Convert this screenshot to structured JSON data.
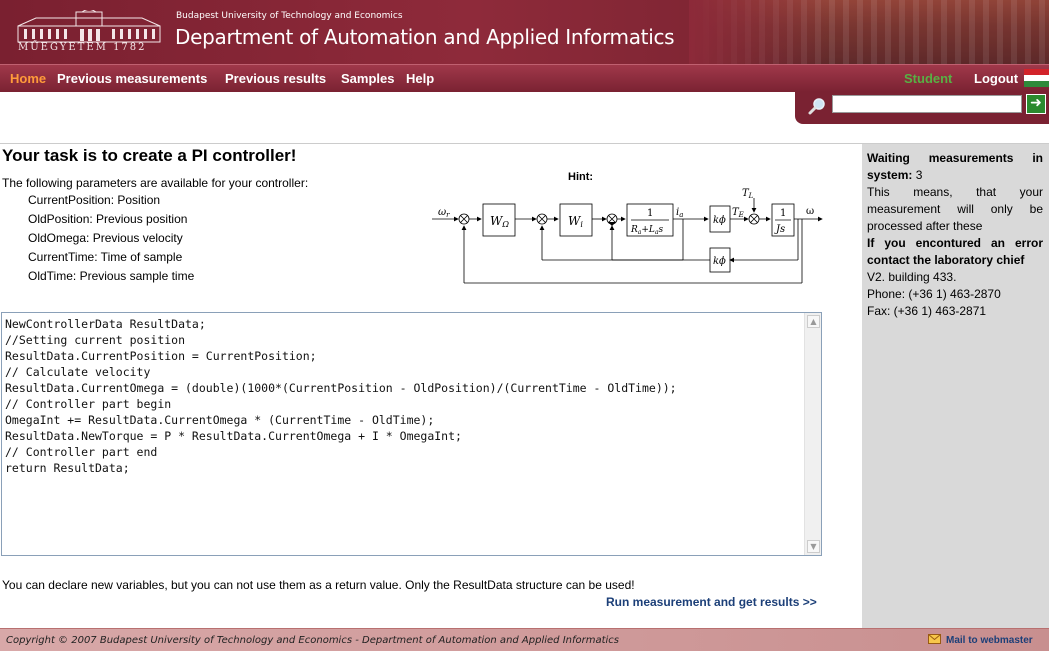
{
  "header": {
    "logo_text": "MŰEGYETEM 1782",
    "university": "Budapest University of Technology and Economics",
    "department": "Department of Automation and Applied Informatics"
  },
  "nav": {
    "items": [
      "Home",
      "Previous measurements",
      "Previous results",
      "Samples",
      "Help"
    ],
    "active": "Home",
    "user": "Student",
    "logout": "Logout"
  },
  "search": {
    "value": "",
    "go_icon": "arrow-right-icon",
    "icon": "magnifier-icon"
  },
  "main": {
    "title": "Your task is to create a PI controller!",
    "params_intro": "The following parameters are available for your controller:",
    "params": [
      "CurrentPosition: Position",
      "OldPosition: Previous position",
      "OldOmega: Previous velocity",
      "CurrentTime: Time of sample",
      "OldTime: Previous sample time"
    ],
    "hint": "Hint:",
    "diagram": {
      "input": "ω",
      "input_sub": "r",
      "block1": "W",
      "block1_sub": "Ω",
      "block2": "W",
      "block2_sub": "i",
      "block3_num": "1",
      "block3_den": "R",
      "block3_den_sub1": "a",
      "block3_den_mid": "+L",
      "block3_den_sub2": "a",
      "block3_den_end": "s",
      "current": "i",
      "current_sub": "a",
      "gain": "kϕ",
      "torque": "T",
      "torque_sub": "E",
      "load": "T",
      "load_sub": "L",
      "inertia_num": "1",
      "inertia_den": "Js",
      "output": "ω",
      "feedback_gain": "kϕ"
    },
    "code": "NewControllerData ResultData;\n//Setting current position\nResultData.CurrentPosition = CurrentPosition;\n// Calculate velocity\nResultData.CurrentOmega = (double)(1000*(CurrentPosition - OldPosition)/(CurrentTime - OldTime));\n// Controller part begin\nOmegaInt += ResultData.CurrentOmega * (CurrentTime - OldTime);\nResultData.NewTorque = P * ResultData.CurrentOmega + I * OmegaInt;\n// Controller part end\nreturn ResultData;",
    "note": "You can declare new variables, but you can not use them as a return value. Only the ResultData structure can be used!",
    "run": "Run measurement and get results >>"
  },
  "side": {
    "waiting_label": "Waiting measurements in system:",
    "waiting_count": "3",
    "waiting_text": "This means, that your measurement will only be processed after these",
    "error_label": "If you encontured an error contact the laboratory chief",
    "address": "V2. building 433.",
    "phone": "Phone: (+36 1) 463-2870",
    "fax": "Fax: (+36 1) 463-2871"
  },
  "footer": {
    "copyright": "Copyright © 2007  Budapest University of Technology and Economics - Department of Automation and Applied Informatics",
    "mail": "Mail to webmaster"
  },
  "colors": {
    "brand": "#7a2232",
    "nav_active": "#ff9b3a",
    "student": "#58b044",
    "link": "#1c3f78"
  }
}
